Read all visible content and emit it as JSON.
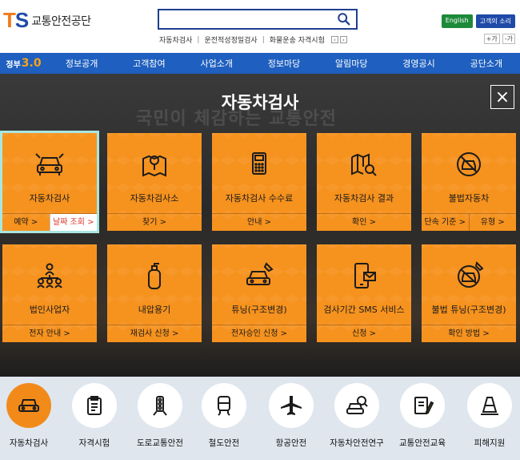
{
  "header": {
    "logo_mark": "TS",
    "org_name": "교통안전공단",
    "search_placeholder": "",
    "quick_links": [
      "자동차검사",
      "운전적성정밀검사",
      "화물운송 자격시험"
    ],
    "btn_english": "English",
    "btn_customer": "고객의 소리",
    "zoom_in": "+가",
    "zoom_out": "-가"
  },
  "nav": {
    "brand_prefix": "정부",
    "brand_num": "3.0",
    "items": [
      "정보공개",
      "고객참여",
      "사업소개",
      "정보마당",
      "알림마당",
      "경영공시",
      "공단소개"
    ]
  },
  "overlay": {
    "title": "자동차검사",
    "background_text": "국민이 체감하는 교통안전",
    "close_label": "×"
  },
  "cards": [
    {
      "title": "자동차검사",
      "links": [
        "예약 >",
        "날짜 조회 >"
      ],
      "icon": "car-wrench-icon",
      "selected": true
    },
    {
      "title": "자동차검사소",
      "links": [
        "찾기 >"
      ],
      "icon": "map-pin-icon"
    },
    {
      "title": "자동차검사 수수료",
      "links": [
        "안내 >"
      ],
      "icon": "calculator-icon"
    },
    {
      "title": "자동차검사 결과",
      "links": [
        "확인 >"
      ],
      "icon": "map-search-icon"
    },
    {
      "title": "불법자동차",
      "links": [
        "단속 기준 >",
        "유형 >"
      ],
      "icon": "prohibited-car-icon"
    },
    {
      "title": "법인사업자",
      "links": [
        "전자 안내 >"
      ],
      "icon": "organization-icon"
    },
    {
      "title": "내압용기",
      "links": [
        "재검사 신청 >"
      ],
      "icon": "gas-cylinder-icon"
    },
    {
      "title": "튜닝(구조변경)",
      "links": [
        "전자승인 신청 >"
      ],
      "icon": "car-tuning-icon"
    },
    {
      "title": "검사기간 SMS 서비스",
      "links": [
        "신청 >"
      ],
      "icon": "phone-sms-icon"
    },
    {
      "title": "불법 튜닝(구조변경)",
      "links": [
        "확인 방법 >"
      ],
      "icon": "prohibited-tuning-icon"
    }
  ],
  "bottom_menu": [
    {
      "label": "자동차검사",
      "icon": "car-inspection-icon",
      "active": true
    },
    {
      "label": "자격시험",
      "icon": "clipboard-icon"
    },
    {
      "label": "도로교통안전",
      "icon": "traffic-light-icon"
    },
    {
      "label": "철도안전",
      "icon": "train-icon"
    },
    {
      "label": "항공안전",
      "icon": "airplane-icon"
    },
    {
      "label": "자동차안전연구",
      "icon": "car-research-icon"
    },
    {
      "label": "교통안전교육",
      "icon": "education-icon"
    },
    {
      "label": "피해지원",
      "icon": "traffic-cone-icon"
    }
  ]
}
